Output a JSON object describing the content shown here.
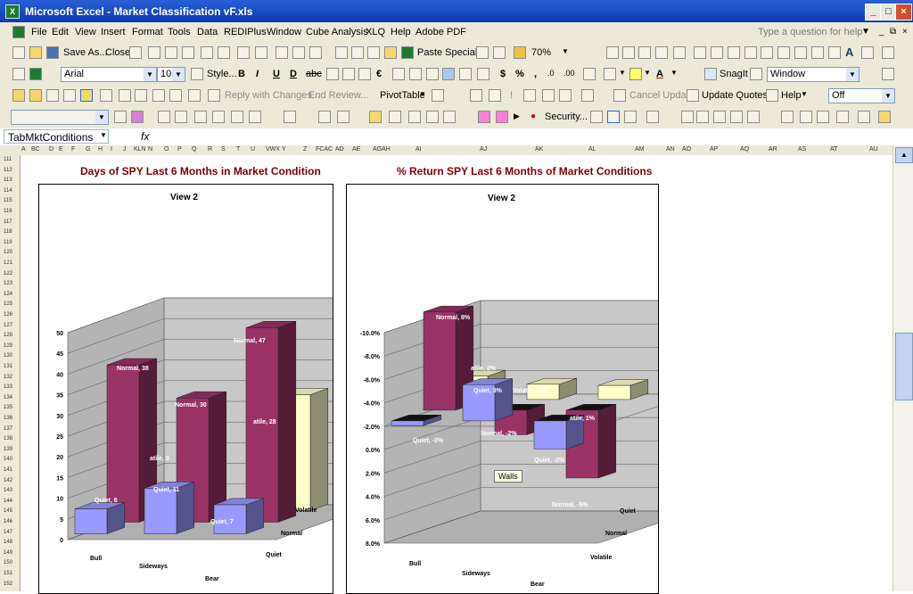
{
  "window": {
    "title": "Microsoft Excel - Market Classification vF.xls"
  },
  "menu": [
    "File",
    "Edit",
    "View",
    "Insert",
    "Format",
    "Tools",
    "Data",
    "REDIPlus",
    "Window",
    "Cube Analysis",
    "XLQ",
    "Help",
    "Adobe PDF"
  ],
  "help_box": "Type a question for help",
  "toolbar1": {
    "save_as": "Save As...",
    "close": "Close",
    "paste_special": "Paste Special...",
    "zoom": "70%"
  },
  "toolbar2": {
    "font": "Arial",
    "size": "10",
    "style": "Style...",
    "bold": "B",
    "italic": "I",
    "underline": "U",
    "currency": "$",
    "percent": "%",
    "comma": ",",
    "snagit": "SnagIt",
    "snagit_target": "Window"
  },
  "toolbar3": {
    "reply": "Reply with Changes...",
    "end_review": "End Review...",
    "pivot": "PivotTable",
    "cancel_update": "Cancel Update",
    "update_quotes": "Update Quotes",
    "help": "Help",
    "off": "Off"
  },
  "toolbar4": {
    "security": "Security..."
  },
  "namebox": "TabMktConditions",
  "fx": "fx",
  "columns": [
    "A",
    "BC",
    "D",
    "E",
    "F",
    "G",
    "H",
    "I",
    "J",
    "KLN",
    "N",
    "O",
    "P",
    "Q",
    "R",
    "S",
    "T",
    "U",
    "VWX",
    "Y",
    "Z",
    "FCAC",
    "AD",
    "AE",
    "AGAH",
    "AI",
    "AJ",
    "AK",
    "AL",
    "AM",
    "AN",
    "AO",
    "AP",
    "AQ",
    "AR",
    "AS",
    "AT",
    "AU"
  ],
  "rows": [
    "111",
    "112",
    "113",
    "114",
    "115",
    "116",
    "117",
    "118",
    "119",
    "120",
    "121",
    "122",
    "123",
    "124",
    "125",
    "126",
    "127",
    "128",
    "129",
    "130",
    "131",
    "132",
    "133",
    "134",
    "135",
    "136",
    "137",
    "138",
    "139",
    "140",
    "141",
    "142",
    "143",
    "144",
    "145",
    "146",
    "147",
    "148",
    "149",
    "150",
    "151",
    "152"
  ],
  "tooltip": "Walls",
  "colors": {
    "normal": "#993366",
    "quiet": "#9999ff",
    "volatile": "#ffffcc",
    "title": "#800000"
  },
  "chart_data": [
    {
      "type": "bar",
      "title": "Days of SPY Last 6 Months in Market Condition",
      "subtitle": "View 2",
      "categories": [
        "Bull",
        "Sideways",
        "Bear"
      ],
      "series": [
        {
          "name": "Quiet",
          "values": [
            6,
            11,
            7
          ]
        },
        {
          "name": "Normal",
          "values": [
            38,
            30,
            47
          ]
        },
        {
          "name": "Volatile",
          "values": [
            0,
            0,
            28
          ]
        }
      ],
      "ylim": [
        0,
        50
      ],
      "yticks": [
        "0",
        "5",
        "10",
        "15",
        "20",
        "25",
        "30",
        "35",
        "40",
        "45",
        "50"
      ],
      "data_labels": [
        "Quiet, 6",
        "Normal, 38",
        "Quiet, 11",
        "Normal, 30",
        "atile, 0",
        "Quiet, 7",
        "Normal, 47",
        "atile, 28"
      ]
    },
    {
      "type": "bar",
      "title": "% Return SPY Last 6 Months of Market Conditions",
      "subtitle": "View 2",
      "categories": [
        "Bull",
        "Sideways",
        "Bear"
      ],
      "series": [
        {
          "name": "Quiet",
          "values": [
            -0.4,
            3.1,
            -2.4
          ]
        },
        {
          "name": "Normal",
          "values": [
            8.4,
            -2.1,
            -5.8
          ]
        },
        {
          "name": "Volatile",
          "values": [
            2.0,
            1.3,
            1.2
          ]
        }
      ],
      "ylim": [
        -10,
        8
      ],
      "yticks": [
        "8.0%",
        "6.0%",
        "4.0%",
        "2.0%",
        "0.0%",
        "-2.0%",
        "-4.0%",
        "-6.0%",
        "-8.0%",
        "-10.0%"
      ],
      "data_labels": [
        "Quiet, -0%",
        "Normal, 8%",
        "atile, 2%",
        "Quiet, 3%",
        "Normal, -2%",
        "Volatile, 1%",
        "Quiet, -2%",
        "Normal, -5%",
        "atile, 1%"
      ]
    }
  ]
}
